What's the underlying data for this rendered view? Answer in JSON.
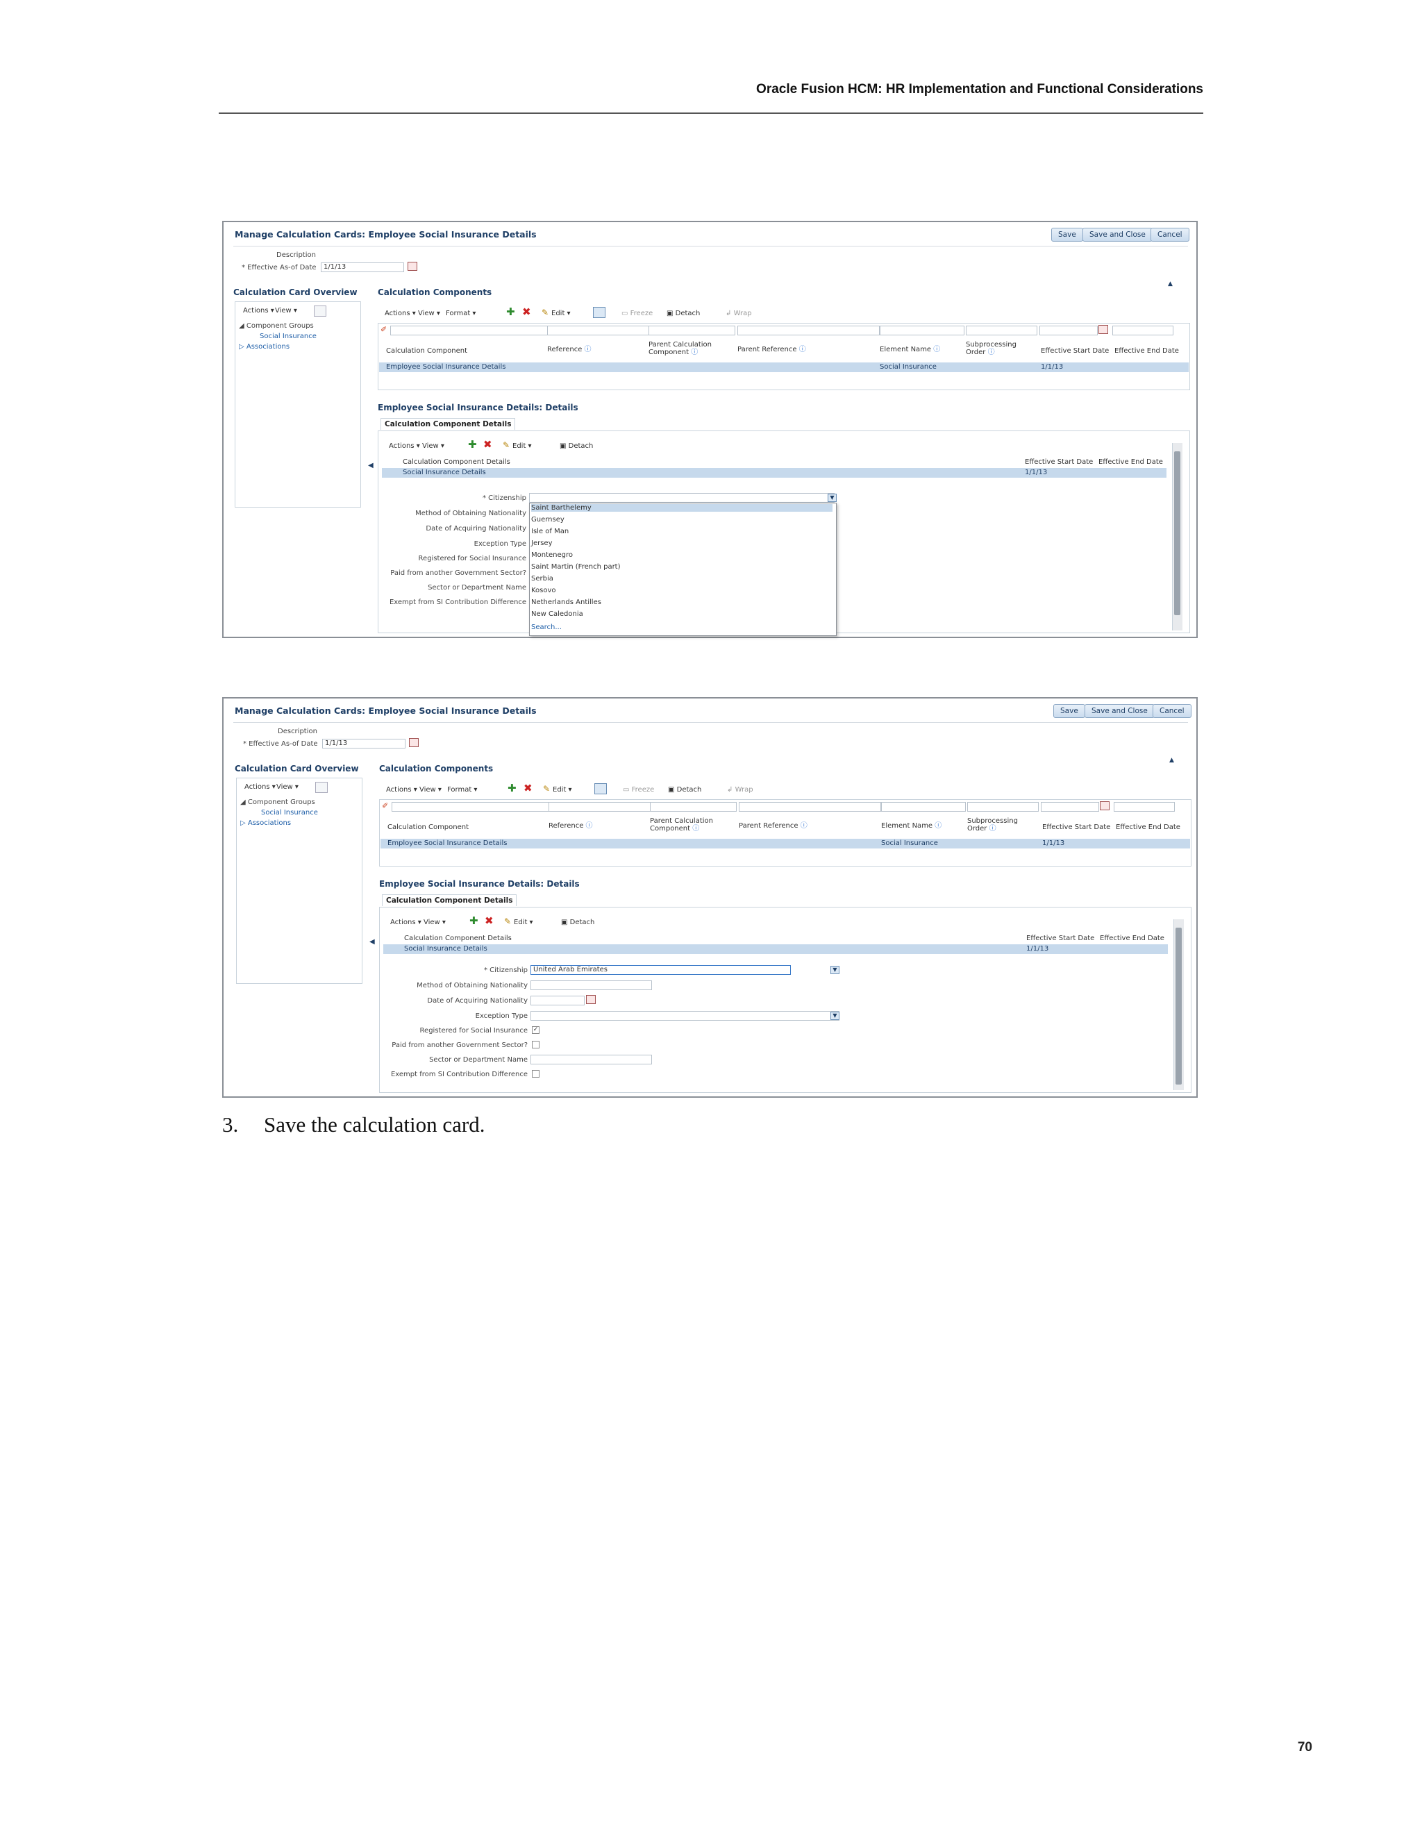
{
  "document": {
    "header": "Oracle Fusion HCM: HR Implementation and Functional Considerations",
    "page_number": "70",
    "step_number": "3.",
    "step_text": "Save the calculation card."
  },
  "screen": {
    "title": "Manage Calculation Cards: Employee Social Insurance Details",
    "buttons": {
      "save": "Save",
      "save_close": "Save and Close",
      "cancel": "Cancel"
    },
    "description_label": "Description",
    "effective_label": "* Effective As-of Date",
    "effective_value": "1/1/13",
    "overview": {
      "title": "Calculation Card Overview",
      "actions": "Actions ▾",
      "view": "View ▾",
      "tree": {
        "component_groups": "Component Groups",
        "social_insurance": "Social Insurance",
        "associations": "Associations"
      }
    },
    "components": {
      "title": "Calculation Components",
      "toolbar": {
        "actions": "Actions ▾",
        "view": "View ▾",
        "format": "Format ▾",
        "edit": "Edit ▾",
        "freeze": "Freeze",
        "detach": "Detach",
        "wrap": "Wrap"
      },
      "columns": {
        "calc_component": "Calculation Component",
        "reference": "Reference",
        "parent_calc_1": "Parent Calculation",
        "parent_calc_2": "Component",
        "parent_reference": "Parent Reference",
        "element_name": "Element Name",
        "subprocessing_1": "Subprocessing",
        "subprocessing_2": "Order",
        "eff_start": "Effective Start Date",
        "eff_end": "Effective End Date"
      },
      "row": {
        "calc_component": "Employee Social Insurance Details",
        "element_name": "Social Insurance",
        "eff_start": "1/1/13"
      }
    },
    "details": {
      "title": "Employee Social Insurance Details: Details",
      "tab": "Calculation Component Details",
      "toolbar": {
        "actions": "Actions ▾",
        "view": "View ▾",
        "edit": "Edit ▾",
        "detach": "Detach"
      },
      "columns": {
        "ccd": "Calculation Component Details",
        "eff_start": "Effective Start Date",
        "eff_end": "Effective End Date"
      },
      "row": {
        "name": "Social Insurance Details",
        "eff_start": "1/1/13"
      },
      "fields": {
        "citizenship": "* Citizenship",
        "method": "Method of Obtaining Nationality",
        "date_acquiring": "Date of Acquiring Nationality",
        "exception": "Exception Type",
        "registered": "Registered for Social Insurance",
        "paid_from": "Paid from another Government Sector?",
        "sector": "Sector or Department Name",
        "exempt": "Exempt from SI Contribution Difference"
      }
    }
  },
  "screenshot_1": {
    "dropdown_items": [
      "Saint Barthelemy",
      "Guernsey",
      "Isle of Man",
      "Jersey",
      "Montenegro",
      "Saint Martin (French part)",
      "Serbia",
      "Kosovo",
      "Netherlands Antilles",
      "New Caledonia"
    ],
    "dropdown_search": "Search..."
  },
  "screenshot_2": {
    "citizenship_value": "United Arab Emirates",
    "registered_checked": "✓"
  },
  "colors": {
    "title_blue": "#1f3f66",
    "link_blue": "#1f5fa8",
    "selected_row": "#c6d9ec"
  }
}
